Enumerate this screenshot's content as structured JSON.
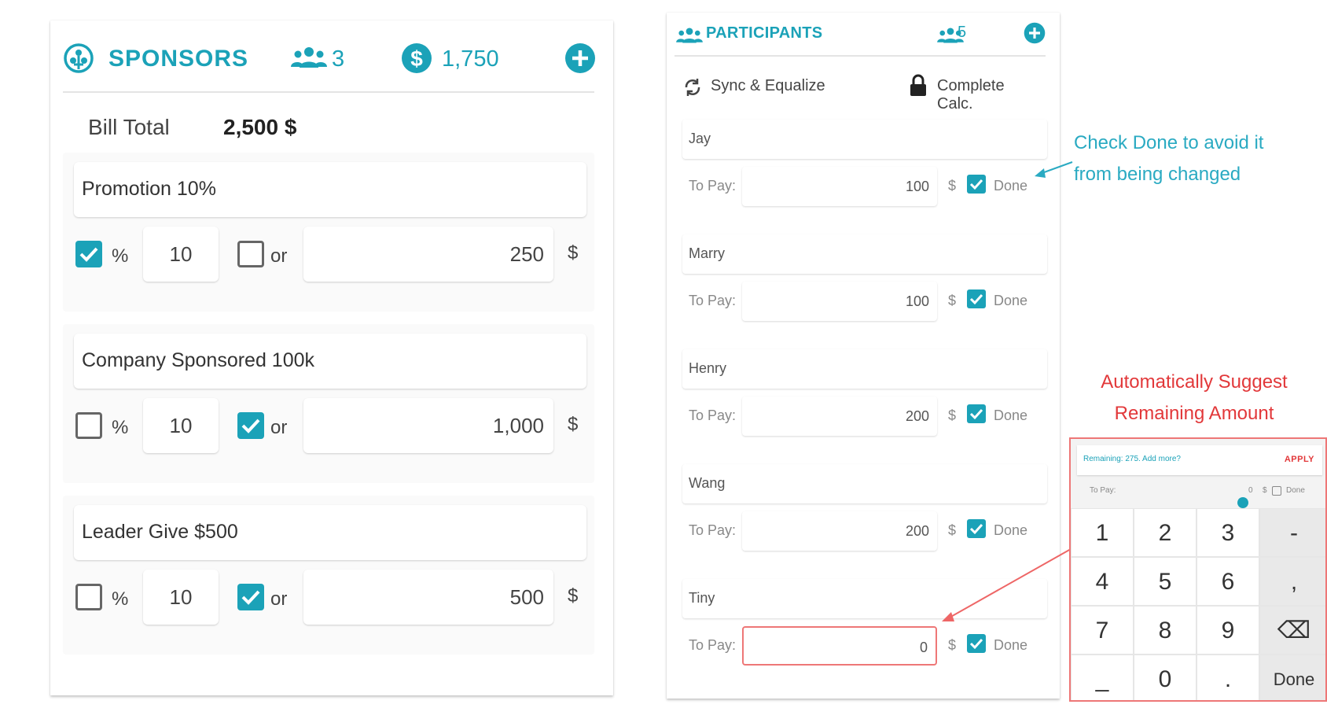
{
  "sponsors": {
    "title": "SPONSORS",
    "count": "3",
    "total": "1,750",
    "bill_label": "Bill Total",
    "bill_value": "2,500 $",
    "items": [
      {
        "name": "Promotion 10%",
        "pct_checked": true,
        "pct_label": "%",
        "pct_value": "10",
        "or_checked": false,
        "or_label": "or",
        "amount": "250",
        "currency": "$"
      },
      {
        "name": "Company Sponsored 100k",
        "pct_checked": false,
        "pct_label": "%",
        "pct_value": "10",
        "or_checked": true,
        "or_label": "or",
        "amount": "1,000",
        "currency": "$"
      },
      {
        "name": "Leader Give $500",
        "pct_checked": false,
        "pct_label": "%",
        "pct_value": "10",
        "or_checked": true,
        "or_label": "or",
        "amount": "500",
        "currency": "$"
      }
    ]
  },
  "participants": {
    "title": "PARTICIPANTS",
    "count": "5",
    "sync_label": "Sync & Equalize",
    "complete_label": "Complete Calc.",
    "to_pay_label": "To Pay:",
    "currency": "$",
    "done_label": "Done",
    "people": [
      {
        "name": "Jay",
        "amount": "100",
        "done": true
      },
      {
        "name": "Marry",
        "amount": "100",
        "done": true
      },
      {
        "name": "Henry",
        "amount": "200",
        "done": true
      },
      {
        "name": "Wang",
        "amount": "200",
        "done": true
      },
      {
        "name": "Tiny",
        "amount": "0",
        "done": true
      }
    ]
  },
  "annotations": {
    "done_tip_line1": "Check Done to avoid it",
    "done_tip_line2": "from being changed",
    "suggest_line1": "Automatically Suggest",
    "suggest_line2": "Remaining Amount"
  },
  "keyboard": {
    "suggestion": "Remaining: 275. Add more?",
    "apply": "APPLY",
    "mini_to_pay": "To Pay:",
    "mini_value": "0",
    "mini_currency": "$",
    "mini_done": "Done",
    "keys": [
      "1",
      "2",
      "3",
      "-",
      "4",
      "5",
      "6",
      ",",
      "7",
      "8",
      "9",
      "⌫",
      "_",
      "0",
      ".",
      "Done"
    ]
  },
  "colors": {
    "accent": "#1ba2b8",
    "annotation_red": "#e2383a",
    "highlight_border": "#ee7777"
  }
}
